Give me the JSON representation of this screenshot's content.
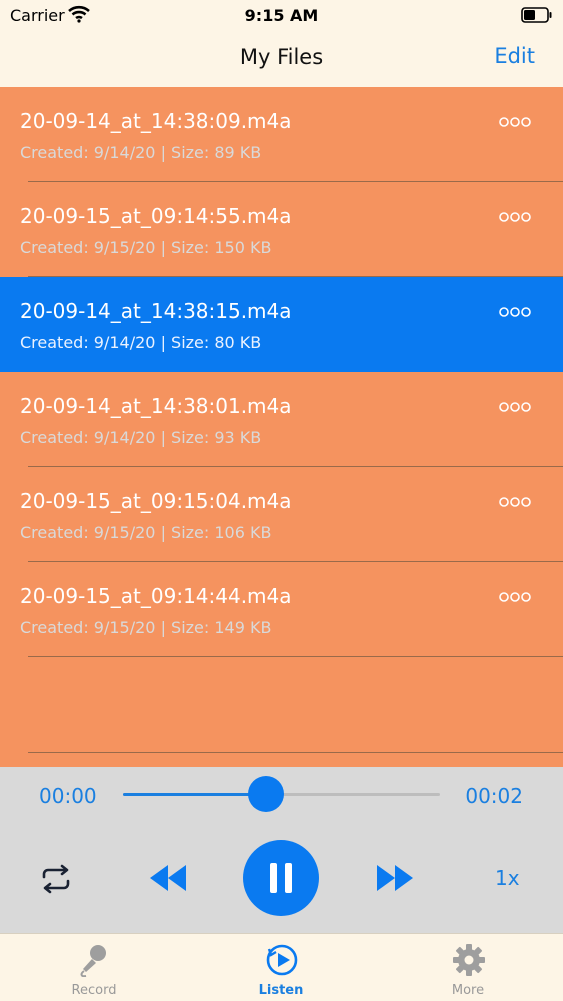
{
  "status_bar": {
    "carrier": "Carrier",
    "time": "9:15 AM"
  },
  "nav": {
    "title": "My Files",
    "edit_label": "Edit"
  },
  "files": [
    {
      "name": "20-09-14_at_14:38:09.m4a",
      "meta": "Created: 9/14/20 | Size: 89 KB",
      "selected": false
    },
    {
      "name": "20-09-15_at_09:14:55.m4a",
      "meta": "Created: 9/15/20 | Size: 150 KB",
      "selected": false
    },
    {
      "name": "20-09-14_at_14:38:15.m4a",
      "meta": "Created: 9/14/20 | Size: 80 KB",
      "selected": true
    },
    {
      "name": "20-09-14_at_14:38:01.m4a",
      "meta": "Created: 9/14/20 | Size: 93 KB",
      "selected": false
    },
    {
      "name": "20-09-15_at_09:15:04.m4a",
      "meta": "Created: 9/15/20 | Size: 106 KB",
      "selected": false
    },
    {
      "name": "20-09-15_at_09:14:44.m4a",
      "meta": "Created: 9/15/20 | Size: 149 KB",
      "selected": false
    }
  ],
  "player": {
    "current_time": "00:00",
    "end_time": "00:02",
    "progress": 0.45,
    "speed": "1x",
    "icons": [
      "repeat-icon",
      "rewind-icon",
      "pause-icon",
      "fast-forward-icon"
    ]
  },
  "tabs": [
    {
      "label": "Record",
      "icon": "microphone-icon",
      "active": false
    },
    {
      "label": "Listen",
      "icon": "play-circle-icon",
      "active": true
    },
    {
      "label": "More",
      "icon": "gear-icon",
      "active": false
    }
  ],
  "colors": {
    "list_background": "#f5935f",
    "selected_row": "#0a7af0",
    "accent": "#1a7fe0",
    "bar_background": "#fdf5e6",
    "player_background": "#d9d9d9"
  }
}
